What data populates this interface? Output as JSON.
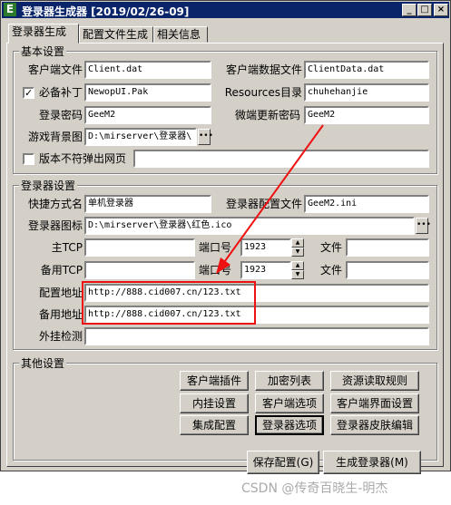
{
  "window": {
    "icon": "E",
    "title": "登录器生成器 [2019/02/26-09]",
    "minimize": "_",
    "maximize": "□",
    "close": "×"
  },
  "tabs": [
    {
      "label": "登录器生成"
    },
    {
      "label": "配置文件生成"
    },
    {
      "label": "相关信息"
    }
  ],
  "basic": {
    "title": "基本设置",
    "client_file_label": "客户端文件",
    "client_file": "Client.dat",
    "client_data_label": "客户端数据文件",
    "client_data": "ClientData.dat",
    "patch_checked": true,
    "patch_label": "必备补丁",
    "patch": "NewopUI.Pak",
    "resources_label": "Resources目录",
    "resources": "chuhehanjie",
    "password_label": "登录密码",
    "password": "GeeM2",
    "update_password_label": "微端更新密码",
    "update_password": "GeeM2",
    "bg_label": "游戏背景图",
    "bg": "D:\\mirserver\\登录器\\",
    "popup_checked": false,
    "popup_label": "版本不符弹出网页",
    "popup_url": ""
  },
  "launcher": {
    "title": "登录器设置",
    "shortcut_label": "快捷方式名",
    "shortcut": "单机登录器",
    "config_label": "登录器配置文件",
    "config": "GeeM2.ini",
    "icon_label": "登录器图标",
    "icon": "D:\\mirserver\\登录器\\红色.ico",
    "main_tcp_label": "主TCP",
    "main_tcp": "",
    "main_port_label": "端口号",
    "main_port": "1923",
    "main_file_label": "文件",
    "main_file": "",
    "backup_tcp_label": "备用TCP",
    "backup_tcp": "",
    "backup_port_label": "端口号",
    "backup_port": "1923",
    "backup_file_label": "文件",
    "backup_file": "",
    "config_url_label": "配置地址",
    "config_url": "http://888.cid007.cn/123.txt",
    "backup_url_label": "备用地址",
    "backup_url": "http://888.cid007.cn/123.txt",
    "plugin_check_label": "外挂检测",
    "plugin_check": ""
  },
  "other": {
    "title": "其他设置",
    "buttons": [
      "客户端插件",
      "加密列表",
      "资源读取规则",
      "内挂设置",
      "客户端选项",
      "客户端界面设置",
      "集成配置",
      "登录器选项",
      "登录器皮肤编辑"
    ]
  },
  "actions": {
    "save": "保存配置(G)",
    "generate": "生成登录器(M)"
  },
  "watermark": "CSDN @传奇百晓生-明杰",
  "colors": {
    "titlebar": "#0a246a",
    "face": "#d4d0c8",
    "highlight": "#ee1111"
  }
}
